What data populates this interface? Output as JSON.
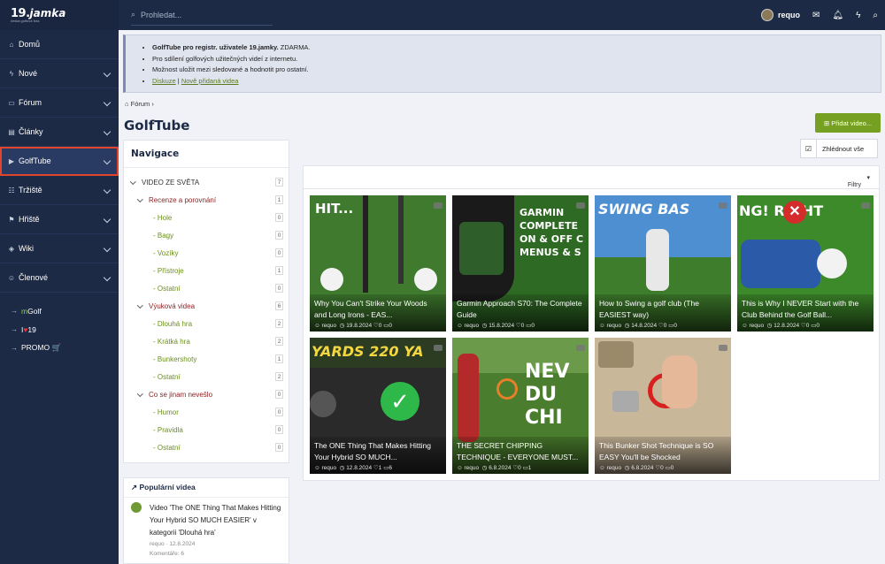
{
  "logo": {
    "number": "19.",
    "name": "jamka",
    "tagline": "česká golfová fóra"
  },
  "search": {
    "placeholder": "Prohledat..."
  },
  "user": {
    "name": "requo"
  },
  "sidebar": {
    "items": [
      {
        "label": "Domů",
        "icon": "home-icon"
      },
      {
        "label": "Nové",
        "icon": "bolt-icon"
      },
      {
        "label": "Fórum",
        "icon": "forum-icon"
      },
      {
        "label": "Články",
        "icon": "article-icon"
      },
      {
        "label": "GolfTube",
        "icon": "video-icon"
      },
      {
        "label": "Tržiště",
        "icon": "market-icon"
      },
      {
        "label": "Hřiště",
        "icon": "flag-icon"
      },
      {
        "label": "Wiki",
        "icon": "wiki-icon"
      },
      {
        "label": "Členové",
        "icon": "members-icon"
      }
    ],
    "links": [
      {
        "prefix": "m",
        "text": "Golf"
      },
      {
        "prefix": "I",
        "text": "19"
      },
      {
        "prefix": "",
        "text": "PROMO 🛒"
      }
    ]
  },
  "notice": {
    "line1_bold": "GolfTube pro registr. uživatele 19.jamky.",
    "line1_rest": " ZDARMA.",
    "line2": "Pro sdílení golfových užitečných videí z internetu.",
    "line3": "Možnost uložit mezi sledované a hodnotit pro ostatní.",
    "link1": "Diskuze",
    "sep": " | ",
    "link2": "Nově přidaná videa"
  },
  "breadcrumb": "Fórum",
  "page_title": "GolfTube",
  "add_button": "Přidat video...",
  "watch_button": "Zhlédnout vše",
  "filter_label": "Filtry",
  "navigation": {
    "title": "Navigace",
    "rows": [
      {
        "label": "VIDEO ZE SVĚTA",
        "count": "7",
        "level": 0
      },
      {
        "label": "Recenze a porovnání",
        "count": "1",
        "level": 1
      },
      {
        "label": "- Hole",
        "count": "0",
        "level": 2
      },
      {
        "label": "- Bagy",
        "count": "0",
        "level": 2
      },
      {
        "label": "- Vozíky",
        "count": "0",
        "level": 2
      },
      {
        "label": "- Přístroje",
        "count": "1",
        "level": 2
      },
      {
        "label": "- Ostatní",
        "count": "0",
        "level": 2
      },
      {
        "label": "Výuková videa",
        "count": "6",
        "level": 1
      },
      {
        "label": "- Dlouhá hra",
        "count": "2",
        "level": 2
      },
      {
        "label": "- Krátká hra",
        "count": "2",
        "level": 2
      },
      {
        "label": "- Bunkershoty",
        "count": "1",
        "level": 2
      },
      {
        "label": "- Ostatní",
        "count": "2",
        "level": 2
      },
      {
        "label": "Co se jinam nevešlo",
        "count": "0",
        "level": 1
      },
      {
        "label": "- Humor",
        "count": "0",
        "level": 2
      },
      {
        "label": "- Pravidla",
        "count": "0",
        "level": 2
      },
      {
        "label": "- Ostatní",
        "count": "0",
        "level": 2
      }
    ]
  },
  "popular": {
    "title": "Populární videa",
    "item_text": "Video 'The ONE Thing That Makes Hitting Your Hybrid SO MUCH EASIER' v kategorii 'Dlouhá hra'",
    "item_meta": "requo · 12.8.2024",
    "item_comments": "Komentáře: 6"
  },
  "videos": [
    {
      "title": "Why You Can't Strike Your Woods and Long Irons - EAS...",
      "user": "requo",
      "date": "19.8.2024",
      "likes": "0",
      "comments": "0",
      "overlay": "HIT...",
      "bg": "#3f7a2e"
    },
    {
      "title": "Garmin Approach S70: The Complete Guide",
      "user": "requo",
      "date": "15.8.2024",
      "likes": "0",
      "comments": "0",
      "overlay": "GARMIN COMPLETE ON & OFF C MENUS & S",
      "bg": "#2f6a24"
    },
    {
      "title": "How to Swing a golf club (The EASIEST way)",
      "user": "requo",
      "date": "14.8.2024",
      "likes": "0",
      "comments": "0",
      "overlay": "SWING BAS",
      "bg": "#4d8fd0"
    },
    {
      "title": "This is Why I NEVER Start with the Club Behind the Golf Ball...",
      "user": "requo",
      "date": "12.8.2024",
      "likes": "0",
      "comments": "0",
      "overlay": "NG! RIGHT",
      "bg": "#3d8a2a"
    },
    {
      "title": "The ONE Thing That Makes Hitting Your Hybrid SO MUCH...",
      "user": "requo",
      "date": "12.8.2024",
      "likes": "1",
      "comments": "6",
      "overlay": "YARDS 220 YA",
      "bg": "#2a2a2a"
    },
    {
      "title": "THE SECRET CHIPPING TECHNIQUE - EVERYONE MUST...",
      "user": "requo",
      "date": "6.8.2024",
      "likes": "0",
      "comments": "1",
      "overlay": "NEV DU CHI",
      "bg": "#4a7d2d"
    },
    {
      "title": "This Bunker Shot Technique is SO EASY You'll be Shocked",
      "user": "requo",
      "date": "6.8.2024",
      "likes": "0",
      "comments": "0",
      "overlay": "",
      "bg": "#c9b79a"
    }
  ],
  "colors": {
    "sidebar": "#1d2a45",
    "accent_green": "#76a021",
    "highlight": "#e2452b"
  }
}
